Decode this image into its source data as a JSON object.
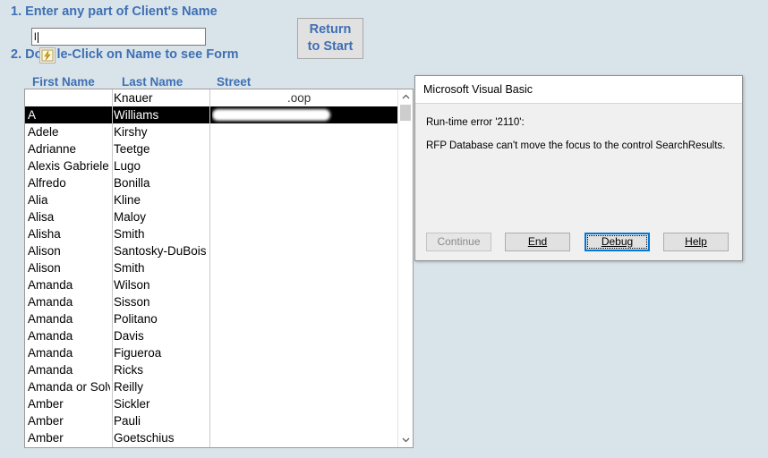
{
  "instructions": {
    "step1": "1. Enter any part of Client's Name",
    "step2_prefix": "2. Do",
    "step2_suffix": "le-Click on Name to see Form"
  },
  "search": {
    "value": "l"
  },
  "return_button": {
    "label": "Return\nto Start"
  },
  "columns": {
    "first_name": "First Name",
    "last_name": "Last Name",
    "street": "Street"
  },
  "rows": [
    {
      "first": "",
      "last": "Knauer",
      "street": ".oop"
    },
    {
      "first": "A",
      "last": "Williams",
      "street": ""
    },
    {
      "first": "Adele",
      "last": "Kirshy",
      "street": ""
    },
    {
      "first": "Adrianne",
      "last": "Teetge",
      "street": ""
    },
    {
      "first": "Alexis Gabriele",
      "last": "Lugo",
      "street": ""
    },
    {
      "first": "Alfredo",
      "last": "Bonilla",
      "street": ""
    },
    {
      "first": "Alia",
      "last": "Kline",
      "street": ""
    },
    {
      "first": "Alisa",
      "last": "Maloy",
      "street": ""
    },
    {
      "first": "Alisha",
      "last": "Smith",
      "street": ""
    },
    {
      "first": "Alison",
      "last": "Santosky-DuBois",
      "street": ""
    },
    {
      "first": "Alison",
      "last": "Smith",
      "street": ""
    },
    {
      "first": "Amanda",
      "last": "Wilson",
      "street": ""
    },
    {
      "first": "Amanda",
      "last": "Sisson",
      "street": ""
    },
    {
      "first": "Amanda",
      "last": "Politano",
      "street": ""
    },
    {
      "first": "Amanda",
      "last": "Davis",
      "street": ""
    },
    {
      "first": "Amanda",
      "last": "Figueroa",
      "street": ""
    },
    {
      "first": "Amanda",
      "last": "Ricks",
      "street": ""
    },
    {
      "first": "Amanda or Solv",
      "last": "Reilly",
      "street": ""
    },
    {
      "first": "Amber",
      "last": "Sickler",
      "street": ""
    },
    {
      "first": "Amber",
      "last": "Pauli",
      "street": ""
    },
    {
      "first": "Amber",
      "last": "Goetschius",
      "street": ""
    }
  ],
  "selected_row": 1,
  "dialog": {
    "title": "Microsoft Visual Basic",
    "error_line": "Run-time error '2110':",
    "message": "RFP Database can't move the focus to the control SearchResults.",
    "buttons": {
      "continue": "Continue",
      "end": "End",
      "debug": "Debug",
      "help": "Help"
    }
  },
  "colors": {
    "accent": "#3f6fb3",
    "background": "#d9e4ea",
    "focus": "#0078d7"
  },
  "icons": {
    "lightning": "lightning-icon",
    "scroll_up": "chevron-up-icon",
    "scroll_down": "chevron-down-icon"
  }
}
